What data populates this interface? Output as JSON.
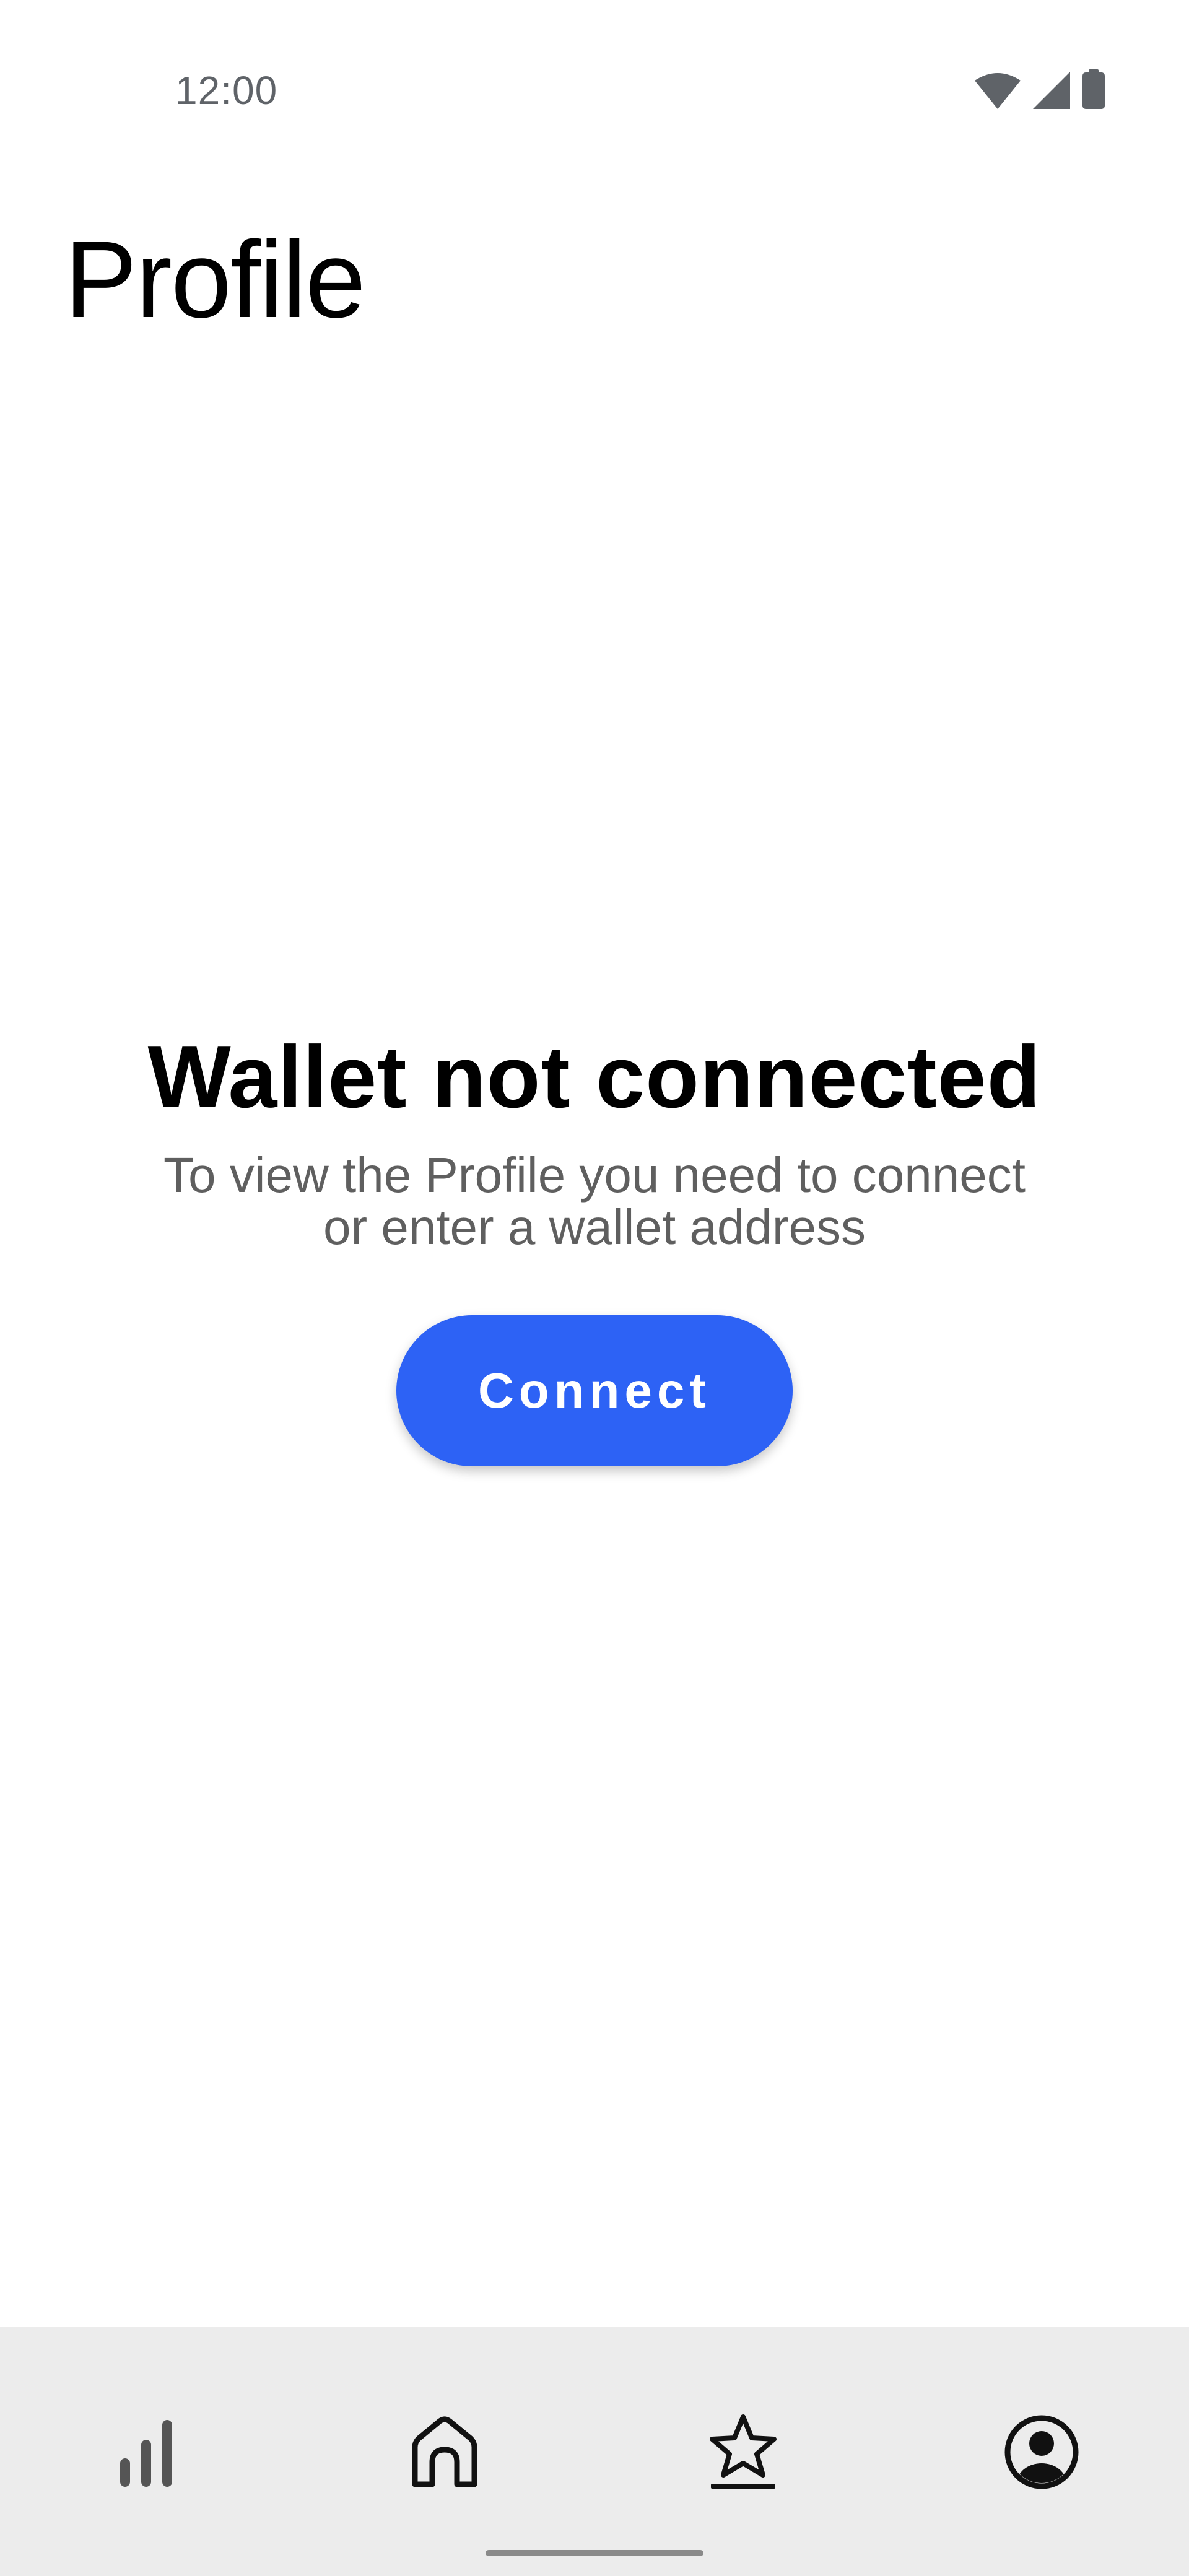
{
  "status_bar": {
    "time": "12:00",
    "icons": [
      "wifi-icon",
      "cellular-signal-icon",
      "battery-icon"
    ]
  },
  "page": {
    "title": "Profile"
  },
  "empty_state": {
    "heading": "Wallet not connected",
    "message": "To view the Profile you need to connect or enter a wallet address",
    "button_label": "Connect"
  },
  "bottom_nav": {
    "items": [
      {
        "icon": "bar-chart-icon",
        "active": false
      },
      {
        "icon": "home-icon",
        "active": false
      },
      {
        "icon": "star-icon",
        "active": false
      },
      {
        "icon": "profile-icon",
        "active": true
      }
    ]
  },
  "colors": {
    "accent": "#2d62f5",
    "nav_background": "#ececec",
    "secondary_text": "#5f5f5f"
  }
}
